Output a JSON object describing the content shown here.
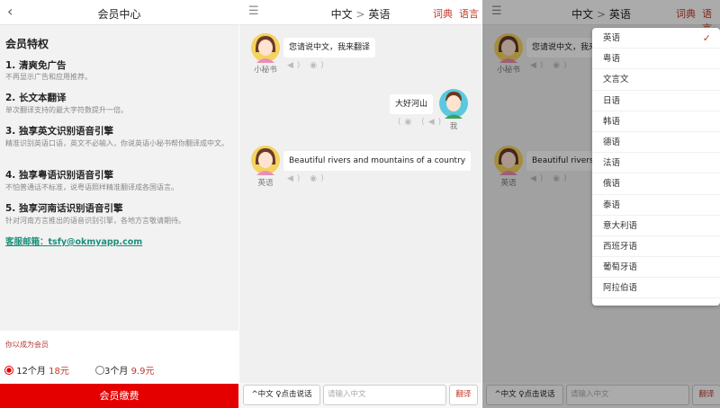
{
  "member": {
    "title": "会员中心",
    "section": "会员特权",
    "features": [
      {
        "title": "1. 清爽免广告",
        "desc": "不再显示广告和应用推荐。"
      },
      {
        "title": "2. 长文本翻译",
        "desc": "单次翻译支持的最大字符数提升一倍。"
      },
      {
        "title": "3. 独享英文识别语音引擎",
        "desc": "精准识别英语口语，英文不必输入，你说英语小秘书帮你翻译成中文。"
      },
      {
        "title": "4. 独享粤语识别语音引擎",
        "desc": "不怕普通话不标准，说粤语照样精准翻译成各国语言。"
      },
      {
        "title": "5. 独享河南话识别语音引擎",
        "desc": "针对河南方言推出的语音识别引擎，各地方言敬请期待。"
      }
    ],
    "email": "客服邮箱：tsfy@okmyapp.com",
    "status": "你以成为会员",
    "plans": [
      {
        "label": "12个月",
        "price": "18元",
        "selected": true
      },
      {
        "label": "3个月",
        "price": "9.9元",
        "selected": false
      }
    ],
    "pay": "会员缴费"
  },
  "chat": {
    "title_from": "中文",
    "title_sep": ">",
    "title_to": "英语",
    "dict": "词典",
    "lang": "语言",
    "messages": [
      {
        "who": "小秘书",
        "text": "您请说中文，我来翻译",
        "side": "left"
      },
      {
        "who": "我",
        "text": "大好河山",
        "side": "right"
      },
      {
        "who": "英语",
        "text": "Beautiful rivers and mountains of a country",
        "side": "left"
      }
    ],
    "switch": "^中文",
    "talk": "♀点击说话",
    "placeholder": "请输入中文",
    "translate": "翻译"
  },
  "languages": {
    "selected": "英语",
    "items": [
      "英语",
      "粤语",
      "文言文",
      "日语",
      "韩语",
      "德语",
      "法语",
      "俄语",
      "泰语",
      "意大利语",
      "西班牙语",
      "葡萄牙语",
      "阿拉伯语"
    ]
  },
  "colors": {
    "accent": "#e50000",
    "link": "#1a8f7a"
  }
}
